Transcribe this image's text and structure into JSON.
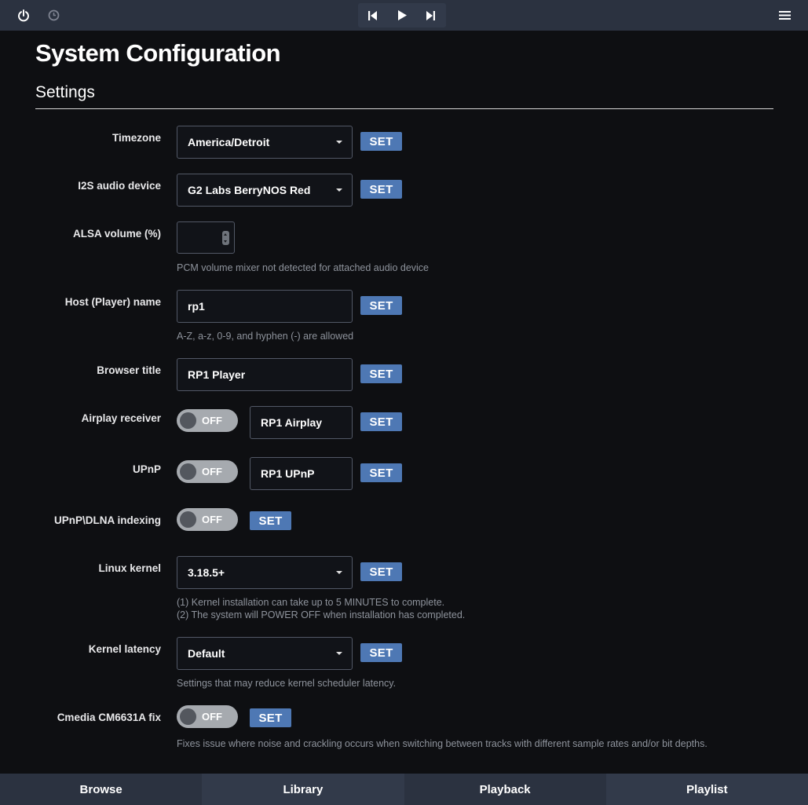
{
  "topbar": {
    "icons": [
      "power-icon",
      "clock-icon",
      "previous-icon",
      "play-icon",
      "next-icon",
      "menu-icon"
    ]
  },
  "page": {
    "title": "System Configuration",
    "section": "Settings"
  },
  "settings": {
    "timezone": {
      "label": "Timezone",
      "value": "America/Detroit",
      "set": "SET"
    },
    "i2s": {
      "label": "I2S audio device",
      "value": "G2 Labs BerryNOS Red",
      "set": "SET"
    },
    "alsa": {
      "label": "ALSA volume (%)",
      "value": "",
      "help": "PCM volume mixer not detected for attached audio device"
    },
    "host": {
      "label": "Host (Player) name",
      "value": "rp1",
      "set": "SET",
      "help": "A-Z, a-z, 0-9, and hyphen (-) are allowed"
    },
    "browser_title": {
      "label": "Browser title",
      "value": "RP1 Player",
      "set": "SET"
    },
    "airplay": {
      "label": "Airplay receiver",
      "toggle": "OFF",
      "value": "RP1 Airplay",
      "set": "SET"
    },
    "upnp": {
      "label": "UPnP",
      "toggle": "OFF",
      "value": "RP1 UPnP",
      "set": "SET"
    },
    "dlna": {
      "label": "UPnP\\DLNA indexing",
      "toggle": "OFF",
      "set": "SET"
    },
    "kernel": {
      "label": "Linux kernel",
      "value": "3.18.5+",
      "set": "SET",
      "help1": "(1) Kernel installation can take up to 5 MINUTES to complete.",
      "help2": "(2) The system will POWER OFF when installation has completed."
    },
    "latency": {
      "label": "Kernel latency",
      "value": "Default",
      "set": "SET",
      "help": "Settings that may reduce kernel scheduler latency."
    },
    "cmedia": {
      "label": "Cmedia CM6631A fix",
      "toggle": "OFF",
      "set": "SET",
      "help": "Fixes issue where noise and crackling occurs when switching between tracks with different sample rates and/or bit depths."
    }
  },
  "tabs": [
    "Browse",
    "Library",
    "Playback",
    "Playlist"
  ]
}
